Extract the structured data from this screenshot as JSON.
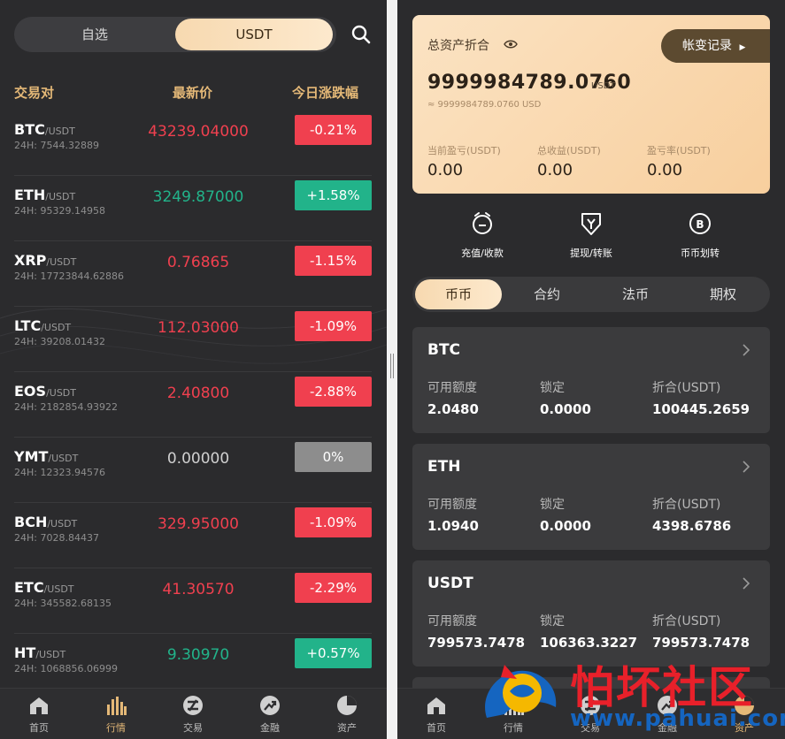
{
  "left": {
    "segment": {
      "options": [
        "自选",
        "USDT"
      ],
      "active": "USDT"
    },
    "headers": {
      "pair": "交易对",
      "price": "最新价",
      "change": "今日涨跌幅"
    },
    "rows": [
      {
        "base": "BTC",
        "quote": "/USDT",
        "vol": "24H: 7544.32889",
        "price": "43239.04000",
        "change": "-0.21%",
        "dir": "down"
      },
      {
        "base": "ETH",
        "quote": "/USDT",
        "vol": "24H: 95329.14958",
        "price": "3249.87000",
        "change": "+1.58%",
        "dir": "up"
      },
      {
        "base": "XRP",
        "quote": "/USDT",
        "vol": "24H: 17723844.62886",
        "price": "0.76865",
        "change": "-1.15%",
        "dir": "down"
      },
      {
        "base": "LTC",
        "quote": "/USDT",
        "vol": "24H: 39208.01432",
        "price": "112.03000",
        "change": "-1.09%",
        "dir": "down"
      },
      {
        "base": "EOS",
        "quote": "/USDT",
        "vol": "24H: 2182854.93922",
        "price": "2.40800",
        "change": "-2.88%",
        "dir": "down"
      },
      {
        "base": "YMT",
        "quote": "/USDT",
        "vol": "24H: 12323.94576",
        "price": "0.00000",
        "change": "0%",
        "dir": "flat"
      },
      {
        "base": "BCH",
        "quote": "/USDT",
        "vol": "24H: 7028.84437",
        "price": "329.95000",
        "change": "-1.09%",
        "dir": "down"
      },
      {
        "base": "ETC",
        "quote": "/USDT",
        "vol": "24H: 345582.68135",
        "price": "41.30570",
        "change": "-2.29%",
        "dir": "down"
      },
      {
        "base": "HT",
        "quote": "/USDT",
        "vol": "24H: 1068856.06999",
        "price": "9.30970",
        "change": "+0.57%",
        "dir": "up"
      }
    ],
    "nav": [
      {
        "label": "首页",
        "icon": "home-icon"
      },
      {
        "label": "行情",
        "icon": "market-icon",
        "active": true
      },
      {
        "label": "交易",
        "icon": "trade-icon"
      },
      {
        "label": "金融",
        "icon": "finance-icon"
      },
      {
        "label": "资产",
        "icon": "assets-icon"
      }
    ]
  },
  "right": {
    "card": {
      "title": "总资产折合",
      "log_button": "帐变记录",
      "total": "9999984789.0760",
      "unit": "USDT",
      "sub": "≈ 9999984789.0760 USD",
      "kpis": [
        {
          "label": "当前盈亏(USDT)",
          "value": "0.00"
        },
        {
          "label": "总收益(USDT)",
          "value": "0.00"
        },
        {
          "label": "盈亏率(USDT)",
          "value": "0.00"
        }
      ]
    },
    "actions": [
      {
        "label": "充值/收款",
        "icon": "deposit-icon"
      },
      {
        "label": "提现/转账",
        "icon": "withdraw-icon"
      },
      {
        "label": "币币划转",
        "icon": "transfer-icon"
      }
    ],
    "tabs": [
      "币币",
      "合约",
      "法币",
      "期权"
    ],
    "active_tab": "币币",
    "accounts": [
      {
        "name": "BTC",
        "available_label": "可用额度",
        "locked_label": "锁定",
        "value_label": "折合(USDT)",
        "available": "2.0480",
        "locked": "0.0000",
        "value": "100445.2659"
      },
      {
        "name": "ETH",
        "available_label": "可用额度",
        "locked_label": "锁定",
        "value_label": "折合(USDT)",
        "available": "1.0940",
        "locked": "0.0000",
        "value": "4398.6786"
      },
      {
        "name": "USDT",
        "available_label": "可用额度",
        "locked_label": "锁定",
        "value_label": "折合(USDT)",
        "available": "799573.7478",
        "locked": "106363.3227",
        "value": "799573.7478"
      }
    ],
    "nav": [
      {
        "label": "首页",
        "icon": "home-icon"
      },
      {
        "label": "行情",
        "icon": "market-icon"
      },
      {
        "label": "交易",
        "icon": "trade-icon"
      },
      {
        "label": "金融",
        "icon": "finance-icon"
      },
      {
        "label": "资产",
        "icon": "assets-icon",
        "active": true
      }
    ]
  },
  "watermark": {
    "text": "怕坏社区",
    "url": "www.pahuai.com"
  },
  "colors": {
    "down": "#f0404f",
    "up": "#22b38a",
    "flat": "#8d8d8d",
    "accent": "#e4b877",
    "card_dark": "#5c4a30"
  }
}
